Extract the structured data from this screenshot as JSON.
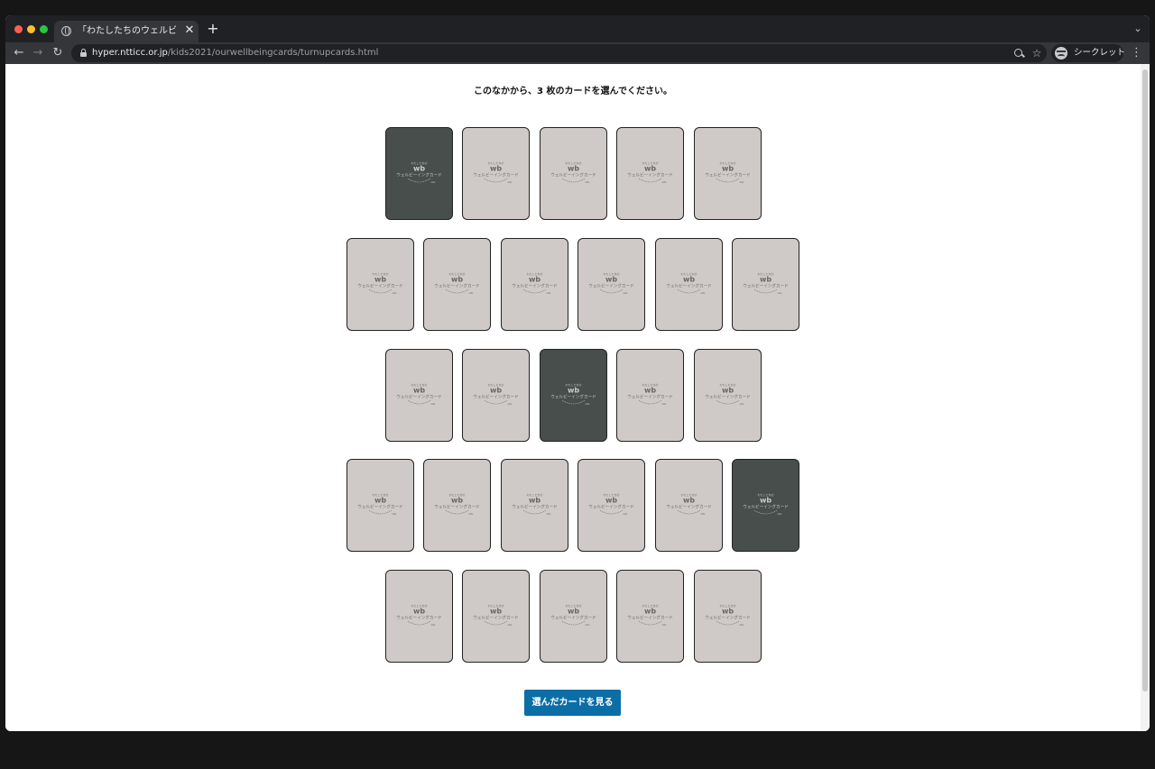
{
  "browser": {
    "tab_title": "「わたしたちのウェルビーイングカード」",
    "new_tab": "+",
    "tab_close": "✕",
    "url_host": "hyper.ntticc.or.jp",
    "url_path": "/kids2021/ourwellbeingcards/turnupcards.html",
    "profile_label": "シークレット"
  },
  "page": {
    "instruction": "このなかから、3 枚のカードを選んでください。",
    "cta_label": "選んだカードを見る"
  },
  "card_logo": {
    "arc_text": "わたしたちの",
    "mark": "wb",
    "name": "ウェルビーイングカード",
    "small": "kids"
  },
  "cards": [
    {
      "state": "selected"
    },
    {
      "state": "face-down"
    },
    {
      "state": "face-down"
    },
    {
      "state": "face-down"
    },
    {
      "state": "face-down"
    },
    {
      "state": "face-down"
    },
    {
      "state": "face-down"
    },
    {
      "state": "face-down"
    },
    {
      "state": "face-down"
    },
    {
      "state": "face-down"
    },
    {
      "state": "face-down"
    },
    {
      "state": "face-down"
    },
    {
      "state": "face-down"
    },
    {
      "state": "selected"
    },
    {
      "state": "face-down"
    },
    {
      "state": "face-down"
    },
    {
      "state": "face-down"
    },
    {
      "state": "face-down"
    },
    {
      "state": "face-down"
    },
    {
      "state": "face-down"
    },
    {
      "state": "face-down"
    },
    {
      "state": "selected"
    },
    {
      "state": "face-down"
    },
    {
      "state": "face-down"
    },
    {
      "state": "face-down"
    },
    {
      "state": "face-down"
    },
    {
      "state": "face-down"
    }
  ],
  "colors": {
    "card_back": "#cfcac7",
    "card_selected": "#474e4c",
    "button": "#0c6ea7"
  }
}
